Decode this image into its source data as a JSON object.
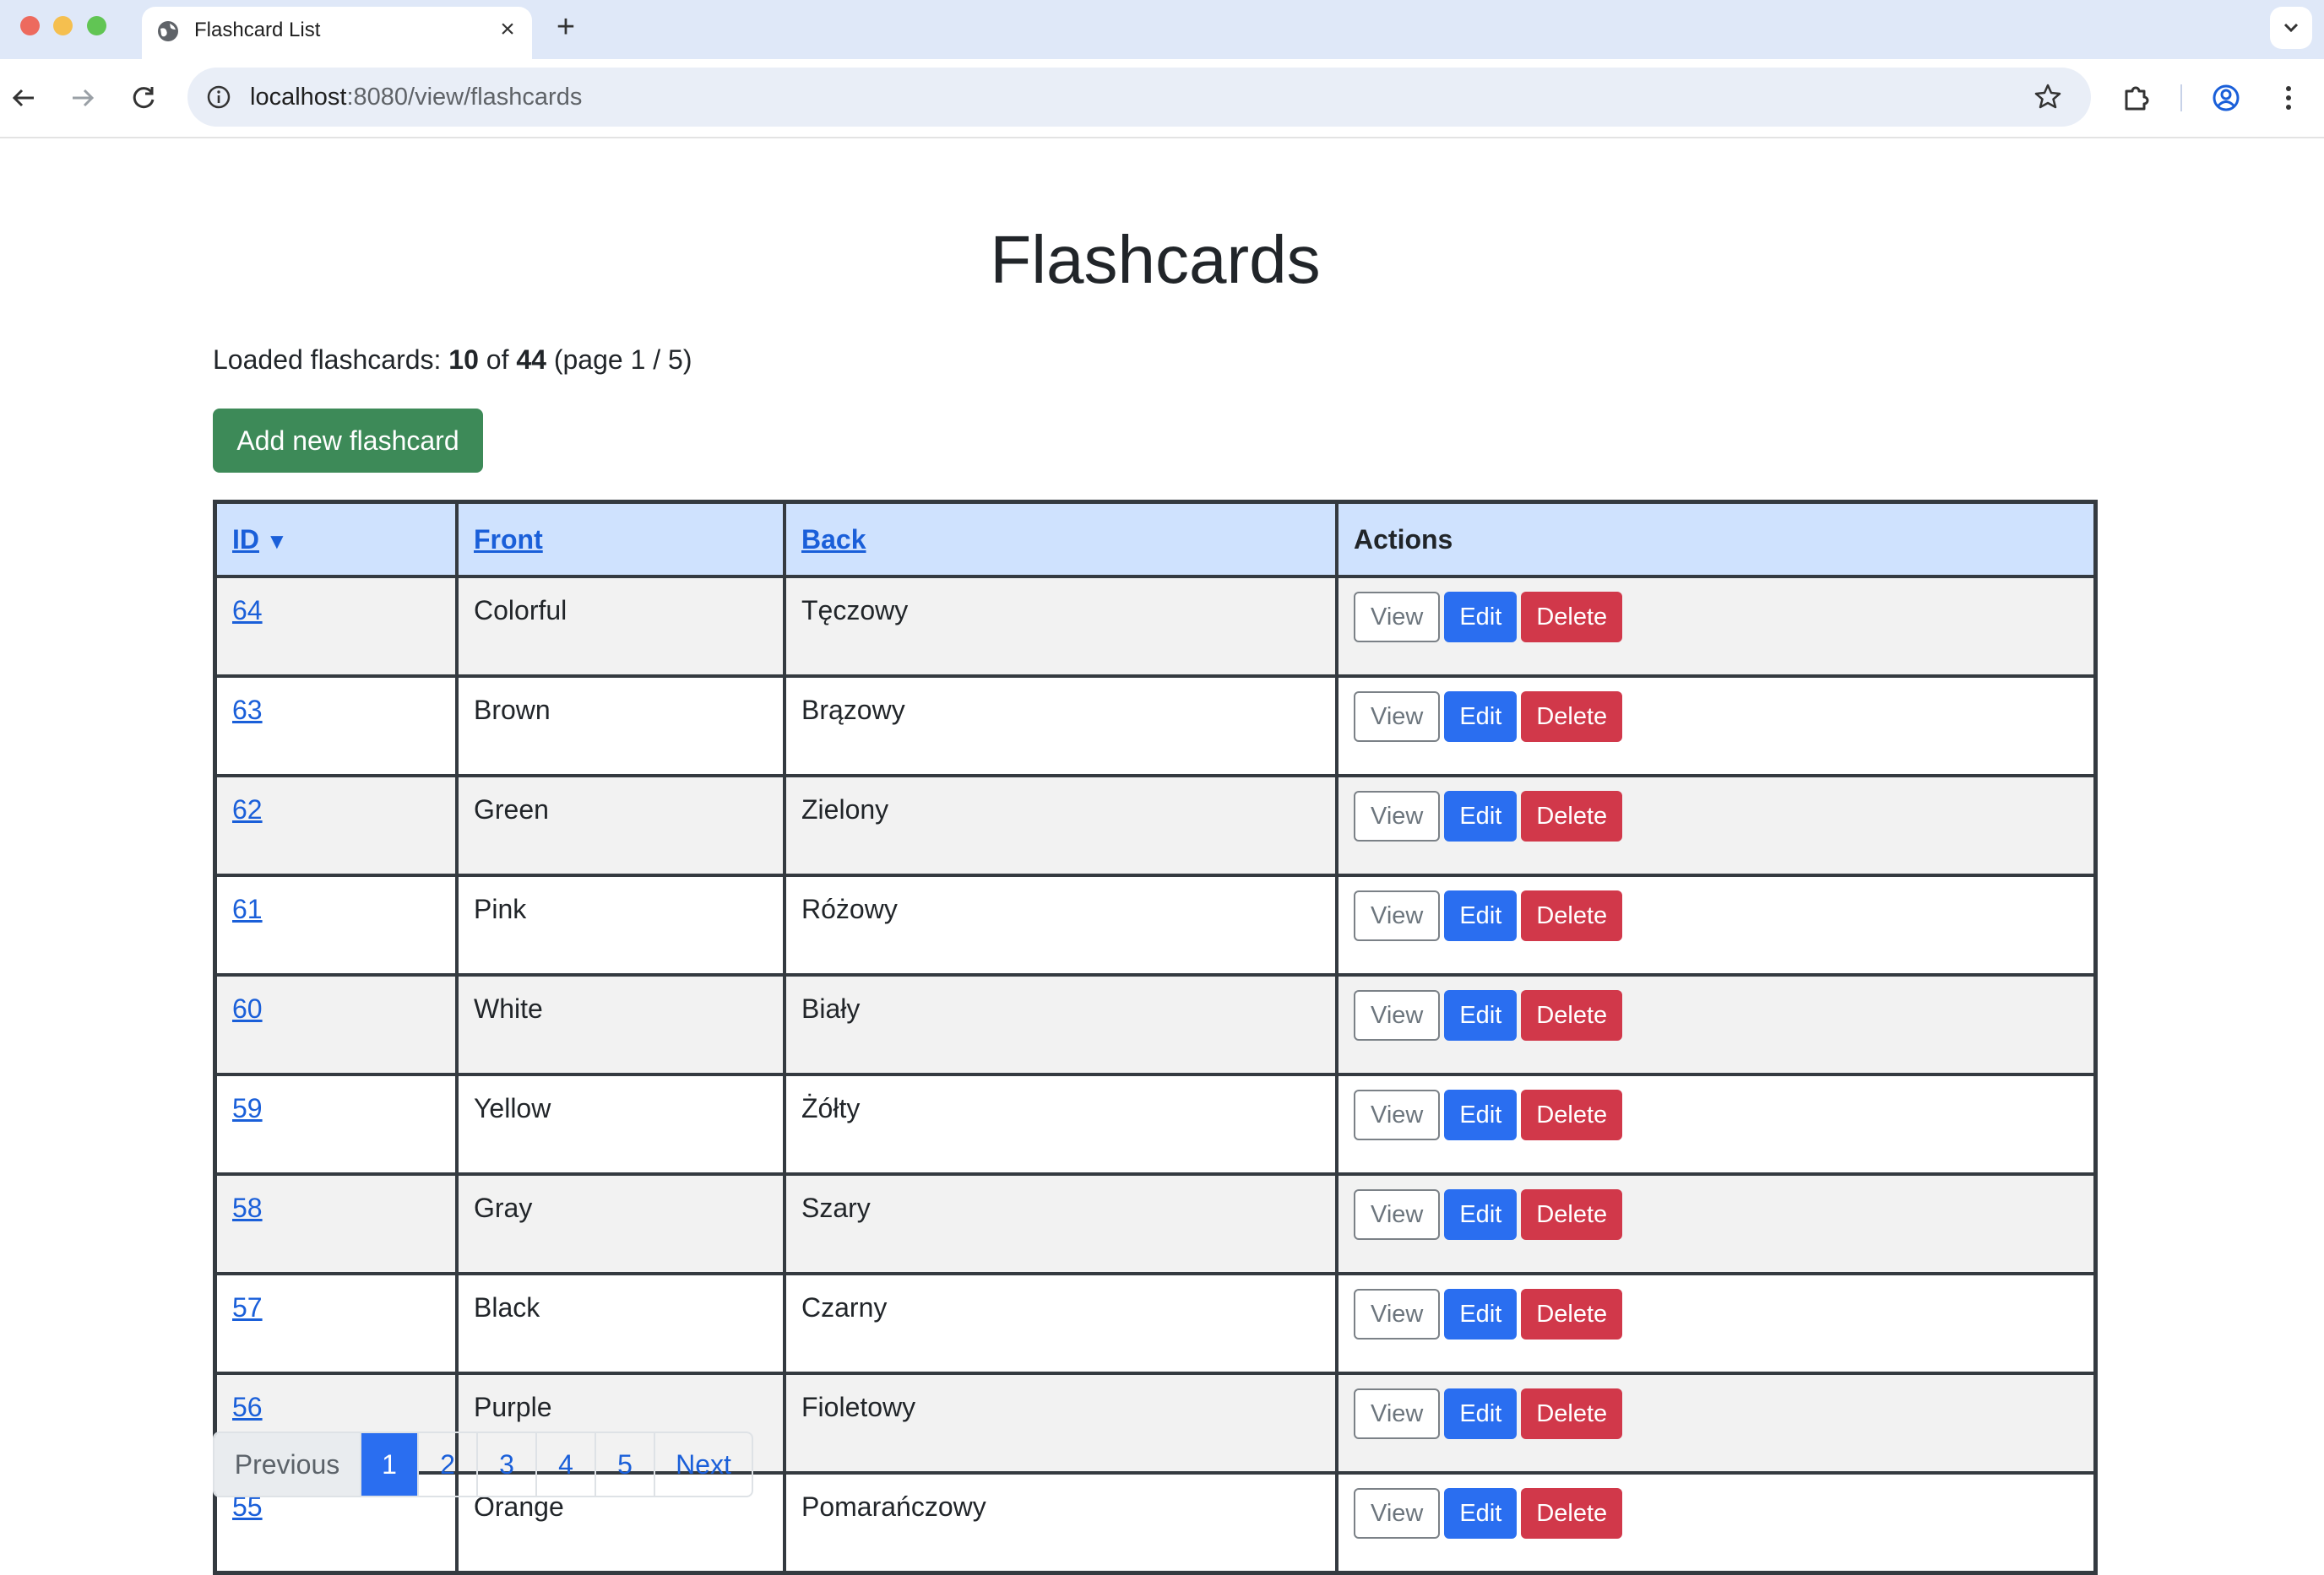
{
  "browser": {
    "tab_title": "Flashcard List",
    "url_host": "localhost",
    "url_rest": ":8080/view/flashcards"
  },
  "page": {
    "title": "Flashcards",
    "summary": {
      "prefix": "Loaded flashcards:",
      "loaded": "10",
      "of_word": "of",
      "total": "44",
      "page_info": "(page 1 / 5)"
    },
    "add_button": "Add new flashcard"
  },
  "table": {
    "headers": {
      "id": "ID",
      "sort_indicator": "▼",
      "front": "Front",
      "back": "Back",
      "actions": "Actions"
    },
    "action_labels": {
      "view": "View",
      "edit": "Edit",
      "delete": "Delete"
    },
    "rows": [
      {
        "id": "64",
        "front": "Colorful",
        "back": "Tęczowy"
      },
      {
        "id": "63",
        "front": "Brown",
        "back": "Brązowy"
      },
      {
        "id": "62",
        "front": "Green",
        "back": "Zielony"
      },
      {
        "id": "61",
        "front": "Pink",
        "back": "Różowy"
      },
      {
        "id": "60",
        "front": "White",
        "back": "Biały"
      },
      {
        "id": "59",
        "front": "Yellow",
        "back": "Żółty"
      },
      {
        "id": "58",
        "front": "Gray",
        "back": "Szary"
      },
      {
        "id": "57",
        "front": "Black",
        "back": "Czarny"
      },
      {
        "id": "56",
        "front": "Purple",
        "back": "Fioletowy"
      },
      {
        "id": "55",
        "front": "Orange",
        "back": "Pomarańczowy"
      }
    ]
  },
  "pagination": {
    "previous": "Previous",
    "pages": [
      "1",
      "2",
      "3",
      "4",
      "5"
    ],
    "active_page": "1",
    "next": "Next"
  },
  "colors": {
    "add_button": "#3d8a58",
    "edit_button": "#2a6ef0",
    "delete_button": "#d1384a",
    "header_background": "#cfe2fe",
    "link": "#1a5fd9"
  }
}
